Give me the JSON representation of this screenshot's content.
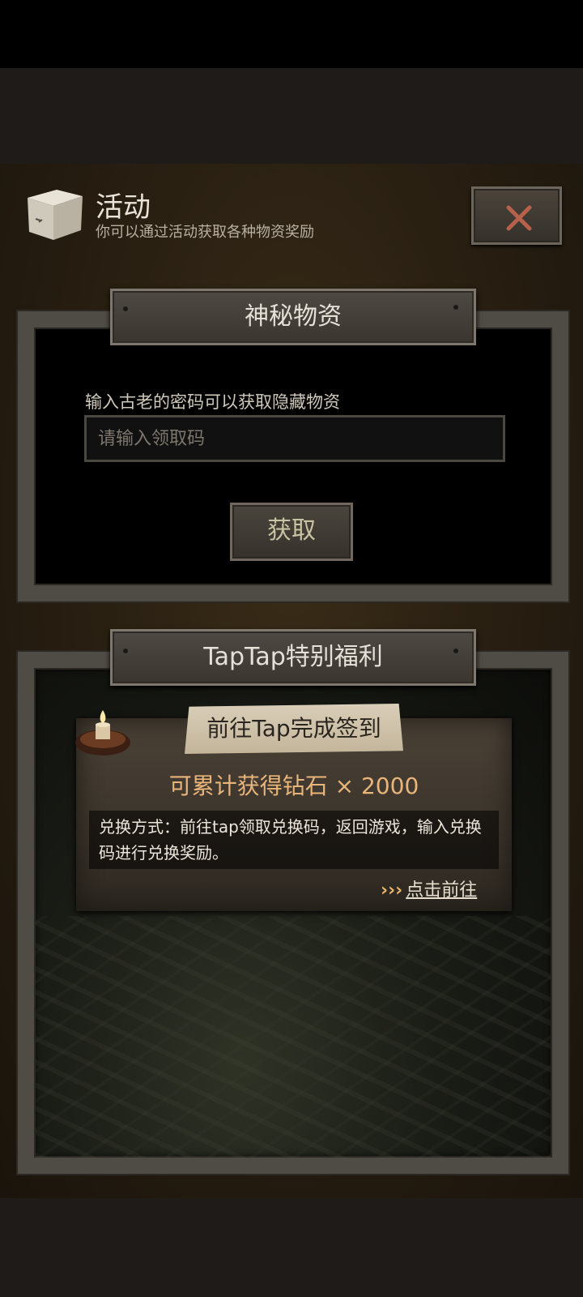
{
  "header": {
    "title": "活动",
    "subtitle": "你可以通过活动获取各种物资奖励"
  },
  "mystery_section": {
    "title": "神秘物资",
    "hint": "输入古老的密码可以获取隐藏物资",
    "input_placeholder": "请输入领取码",
    "input_value": "",
    "button_label": "获取"
  },
  "taptap_section": {
    "title": "TapTap特别福利",
    "tag_label": "前往Tap完成签到",
    "reward_text": "可累计获得钻石 × 2000",
    "method_text": "兑换方式：前往tap领取兑换码，返回游戏，输入兑换码进行兑换奖励。",
    "link_chevrons": "›››",
    "link_label": "点击前往"
  },
  "icons": {
    "header_icon": "box-icon",
    "close": "close-icon",
    "candle": "candle-icon"
  },
  "colors": {
    "accent_orange": "#e9b57a",
    "close_x": "#b8614a",
    "button_text": "#c8c3a2"
  }
}
